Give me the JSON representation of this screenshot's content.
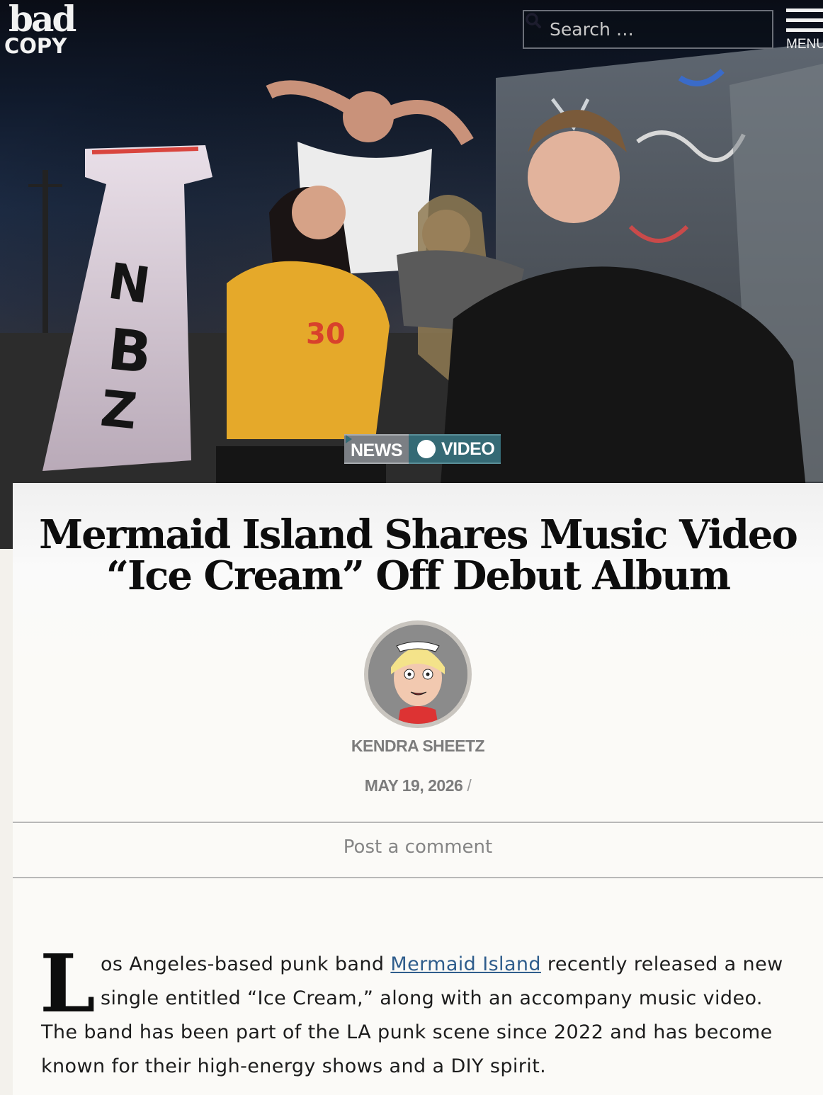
{
  "header": {
    "logo_line1": "bad",
    "logo_line2": "COPY",
    "search_placeholder": "Search …",
    "menu_label": "MENU"
  },
  "hero": {
    "categories": [
      "NEWS",
      "VIDEO"
    ]
  },
  "article": {
    "title_line1": "Mermaid Island Shares Music Video",
    "title_line2": "“Ice Cream” Off Debut Album",
    "author": "KENDRA SHEETZ",
    "date": "MAY 19, 2026",
    "date_separator": "/",
    "comment_link": "Post a comment",
    "dropcap": "L",
    "body_before_link": "os Angeles-based punk band ",
    "body_link": "Mermaid Island",
    "body_after_link": " recently released a new single entitled “Ice Cream,” along with an accompany music video. The band has been part of the LA punk scene since 2022 and has become known for their high-energy shows and a DIY spirit."
  },
  "colors": {
    "accent_purple": "#8b7ed8",
    "video_tag": "#356a75",
    "news_tag": "#7b7f84",
    "link": "#2f5d8c"
  }
}
